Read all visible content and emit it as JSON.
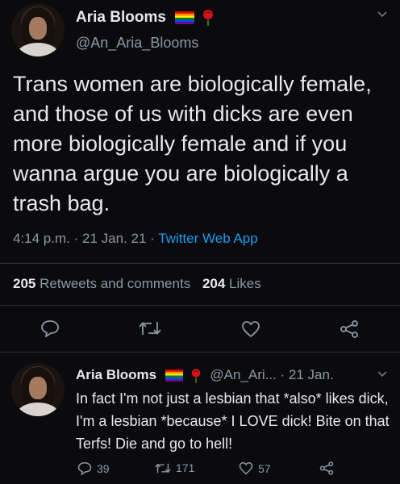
{
  "main_tweet": {
    "display_name": "Aria Blooms",
    "handle": "@An_Aria_Blooms",
    "text": "Trans women are biologically female, and those of us with dicks are even more biologically female and if you wanna argue you are biologically a trash bag.",
    "time": "4:14 p.m.",
    "date": "21 Jan. 21",
    "app": "Twitter Web App",
    "retweets_count": "205",
    "retweets_label": "Retweets and comments",
    "likes_count": "204",
    "likes_label": "Likes"
  },
  "reply_tweet": {
    "display_name": "Aria Blooms",
    "handle": "@An_Ari...",
    "date": "21 Jan.",
    "text": "In fact I'm not just a lesbian that *also* likes dick, I'm a lesbian *because* I LOVE dick! Bite on that Terfs! Die and go to hell!",
    "reply_count": "39",
    "retweet_count": "171",
    "like_count": "57"
  },
  "colors": {
    "background": "#0b0b0d",
    "text": "#e7e9ea",
    "muted": "#8b98a5",
    "link": "#1d9bf0"
  }
}
